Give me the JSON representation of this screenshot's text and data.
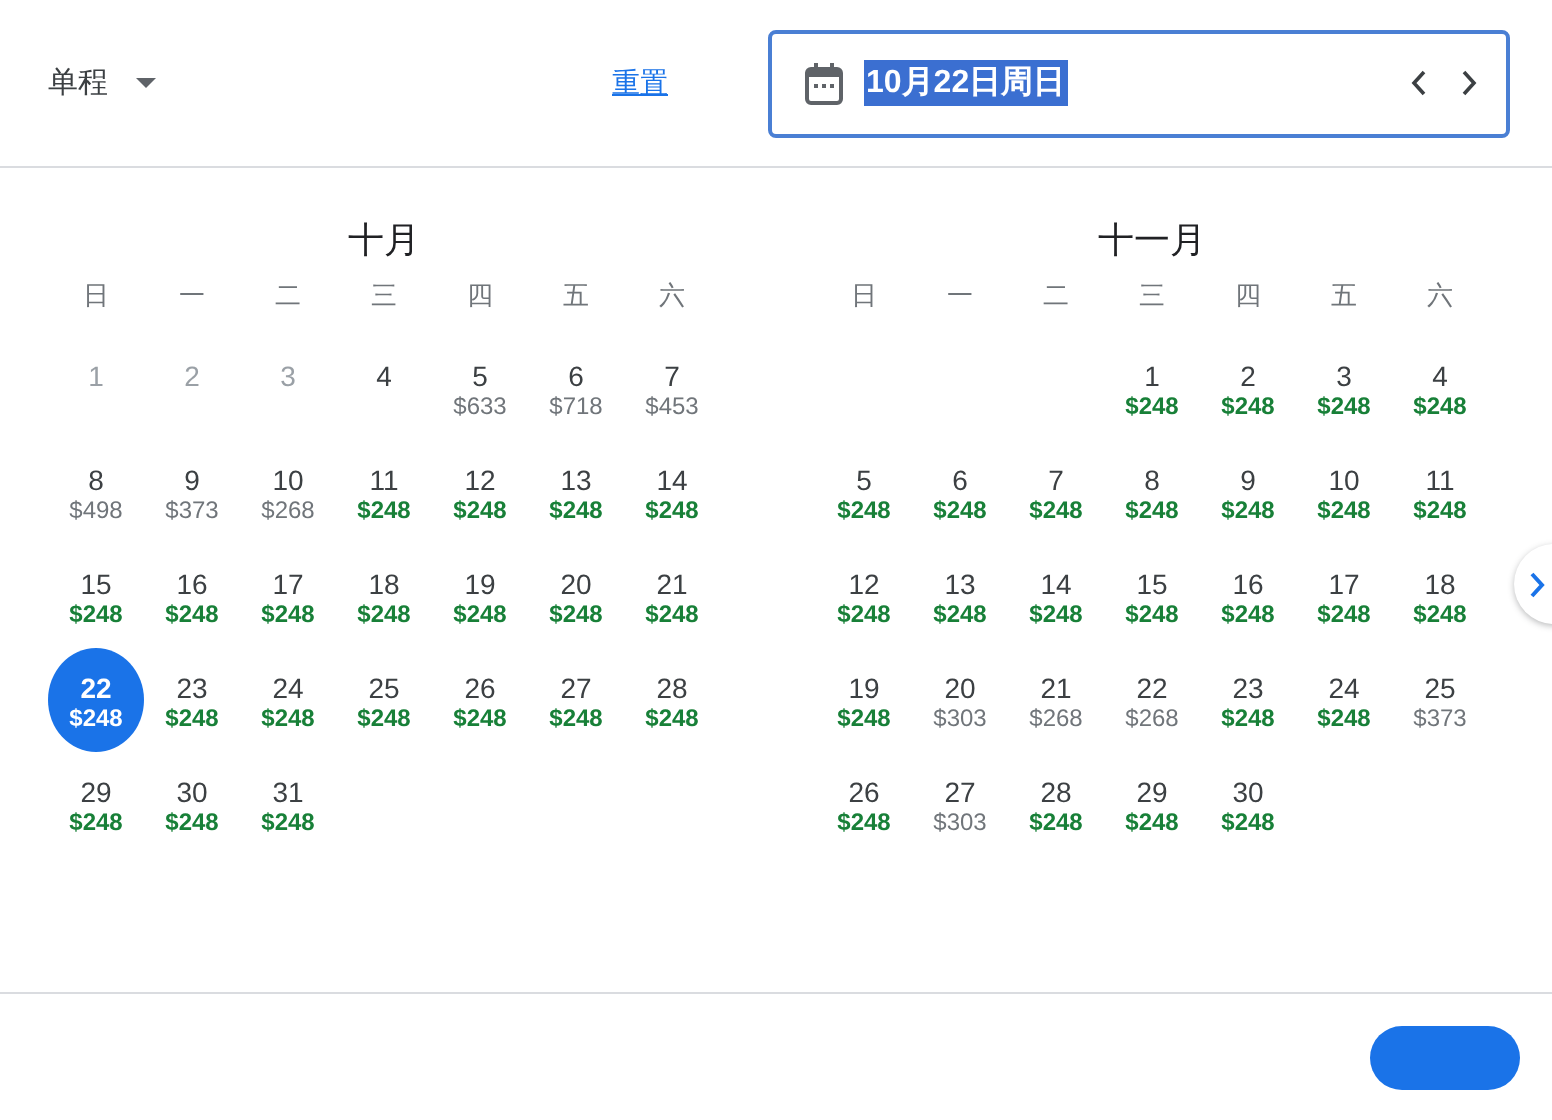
{
  "trip_type": {
    "label": "单程"
  },
  "reset_link": "重置",
  "date_field": {
    "value": "10月22日周日"
  },
  "months": [
    {
      "title": "十月",
      "weekdays": [
        "日",
        "一",
        "二",
        "三",
        "四",
        "五",
        "六"
      ],
      "weeks": [
        [
          {
            "day": "1",
            "disabled": true,
            "selected": false
          },
          {
            "day": "2",
            "disabled": true,
            "selected": false
          },
          {
            "day": "3",
            "disabled": true,
            "selected": false
          },
          {
            "day": "4",
            "disabled": false,
            "selected": false
          },
          {
            "day": "5",
            "price": "$633",
            "kind": "normal",
            "disabled": false,
            "selected": false
          },
          {
            "day": "6",
            "price": "$718",
            "kind": "normal",
            "disabled": false,
            "selected": false
          },
          {
            "day": "7",
            "price": "$453",
            "kind": "normal",
            "disabled": false,
            "selected": false
          }
        ],
        [
          {
            "day": "8",
            "price": "$498",
            "kind": "normal",
            "disabled": false,
            "selected": false
          },
          {
            "day": "9",
            "price": "$373",
            "kind": "normal",
            "disabled": false,
            "selected": false
          },
          {
            "day": "10",
            "price": "$268",
            "kind": "normal",
            "disabled": false,
            "selected": false
          },
          {
            "day": "11",
            "price": "$248",
            "kind": "low",
            "disabled": false,
            "selected": false
          },
          {
            "day": "12",
            "price": "$248",
            "kind": "low",
            "disabled": false,
            "selected": false
          },
          {
            "day": "13",
            "price": "$248",
            "kind": "low",
            "disabled": false,
            "selected": false
          },
          {
            "day": "14",
            "price": "$248",
            "kind": "low",
            "disabled": false,
            "selected": false
          }
        ],
        [
          {
            "day": "15",
            "price": "$248",
            "kind": "low",
            "disabled": false,
            "selected": false
          },
          {
            "day": "16",
            "price": "$248",
            "kind": "low",
            "disabled": false,
            "selected": false
          },
          {
            "day": "17",
            "price": "$248",
            "kind": "low",
            "disabled": false,
            "selected": false
          },
          {
            "day": "18",
            "price": "$248",
            "kind": "low",
            "disabled": false,
            "selected": false
          },
          {
            "day": "19",
            "price": "$248",
            "kind": "low",
            "disabled": false,
            "selected": false
          },
          {
            "day": "20",
            "price": "$248",
            "kind": "low",
            "disabled": false,
            "selected": false
          },
          {
            "day": "21",
            "price": "$248",
            "kind": "low",
            "disabled": false,
            "selected": false
          }
        ],
        [
          {
            "day": "22",
            "price": "$248",
            "kind": "low",
            "disabled": false,
            "selected": true
          },
          {
            "day": "23",
            "price": "$248",
            "kind": "low",
            "disabled": false,
            "selected": false
          },
          {
            "day": "24",
            "price": "$248",
            "kind": "low",
            "disabled": false,
            "selected": false
          },
          {
            "day": "25",
            "price": "$248",
            "kind": "low",
            "disabled": false,
            "selected": false
          },
          {
            "day": "26",
            "price": "$248",
            "kind": "low",
            "disabled": false,
            "selected": false
          },
          {
            "day": "27",
            "price": "$248",
            "kind": "low",
            "disabled": false,
            "selected": false
          },
          {
            "day": "28",
            "price": "$248",
            "kind": "low",
            "disabled": false,
            "selected": false
          }
        ],
        [
          {
            "day": "29",
            "price": "$248",
            "kind": "low",
            "disabled": false,
            "selected": false
          },
          {
            "day": "30",
            "price": "$248",
            "kind": "low",
            "disabled": false,
            "selected": false
          },
          {
            "day": "31",
            "price": "$248",
            "kind": "low",
            "disabled": false,
            "selected": false
          },
          {
            "kind": "empty"
          },
          {
            "kind": "empty"
          },
          {
            "kind": "empty"
          },
          {
            "kind": "empty"
          }
        ]
      ]
    },
    {
      "title": "十一月",
      "weekdays": [
        "日",
        "一",
        "二",
        "三",
        "四",
        "五",
        "六"
      ],
      "weeks": [
        [
          {
            "kind": "empty"
          },
          {
            "kind": "empty"
          },
          {
            "kind": "empty"
          },
          {
            "day": "1",
            "price": "$248",
            "kind": "low",
            "disabled": false,
            "selected": false
          },
          {
            "day": "2",
            "price": "$248",
            "kind": "low",
            "disabled": false,
            "selected": false
          },
          {
            "day": "3",
            "price": "$248",
            "kind": "low",
            "disabled": false,
            "selected": false
          },
          {
            "day": "4",
            "price": "$248",
            "kind": "low",
            "disabled": false,
            "selected": false
          }
        ],
        [
          {
            "day": "5",
            "price": "$248",
            "kind": "low",
            "disabled": false,
            "selected": false
          },
          {
            "day": "6",
            "price": "$248",
            "kind": "low",
            "disabled": false,
            "selected": false
          },
          {
            "day": "7",
            "price": "$248",
            "kind": "low",
            "disabled": false,
            "selected": false
          },
          {
            "day": "8",
            "price": "$248",
            "kind": "low",
            "disabled": false,
            "selected": false
          },
          {
            "day": "9",
            "price": "$248",
            "kind": "low",
            "disabled": false,
            "selected": false
          },
          {
            "day": "10",
            "price": "$248",
            "kind": "low",
            "disabled": false,
            "selected": false
          },
          {
            "day": "11",
            "price": "$248",
            "kind": "low",
            "disabled": false,
            "selected": false
          }
        ],
        [
          {
            "day": "12",
            "price": "$248",
            "kind": "low",
            "disabled": false,
            "selected": false
          },
          {
            "day": "13",
            "price": "$248",
            "kind": "low",
            "disabled": false,
            "selected": false
          },
          {
            "day": "14",
            "price": "$248",
            "kind": "low",
            "disabled": false,
            "selected": false
          },
          {
            "day": "15",
            "price": "$248",
            "kind": "low",
            "disabled": false,
            "selected": false
          },
          {
            "day": "16",
            "price": "$248",
            "kind": "low",
            "disabled": false,
            "selected": false
          },
          {
            "day": "17",
            "price": "$248",
            "kind": "low",
            "disabled": false,
            "selected": false
          },
          {
            "day": "18",
            "price": "$248",
            "kind": "low",
            "disabled": false,
            "selected": false
          }
        ],
        [
          {
            "day": "19",
            "price": "$248",
            "kind": "low",
            "disabled": false,
            "selected": false
          },
          {
            "day": "20",
            "price": "$303",
            "kind": "normal",
            "disabled": false,
            "selected": false
          },
          {
            "day": "21",
            "price": "$268",
            "kind": "normal",
            "disabled": false,
            "selected": false
          },
          {
            "day": "22",
            "price": "$268",
            "kind": "normal",
            "disabled": false,
            "selected": false
          },
          {
            "day": "23",
            "price": "$248",
            "kind": "low",
            "disabled": false,
            "selected": false
          },
          {
            "day": "24",
            "price": "$248",
            "kind": "low",
            "disabled": false,
            "selected": false
          },
          {
            "day": "25",
            "price": "$373",
            "kind": "normal",
            "disabled": false,
            "selected": false
          }
        ],
        [
          {
            "day": "26",
            "price": "$248",
            "kind": "low",
            "disabled": false,
            "selected": false
          },
          {
            "day": "27",
            "price": "$303",
            "kind": "normal",
            "disabled": false,
            "selected": false
          },
          {
            "day": "28",
            "price": "$248",
            "kind": "low",
            "disabled": false,
            "selected": false
          },
          {
            "day": "29",
            "price": "$248",
            "kind": "low",
            "disabled": false,
            "selected": false
          },
          {
            "day": "30",
            "price": "$248",
            "kind": "low",
            "disabled": false,
            "selected": false
          },
          {
            "kind": "empty"
          },
          {
            "kind": "empty"
          }
        ]
      ]
    }
  ]
}
